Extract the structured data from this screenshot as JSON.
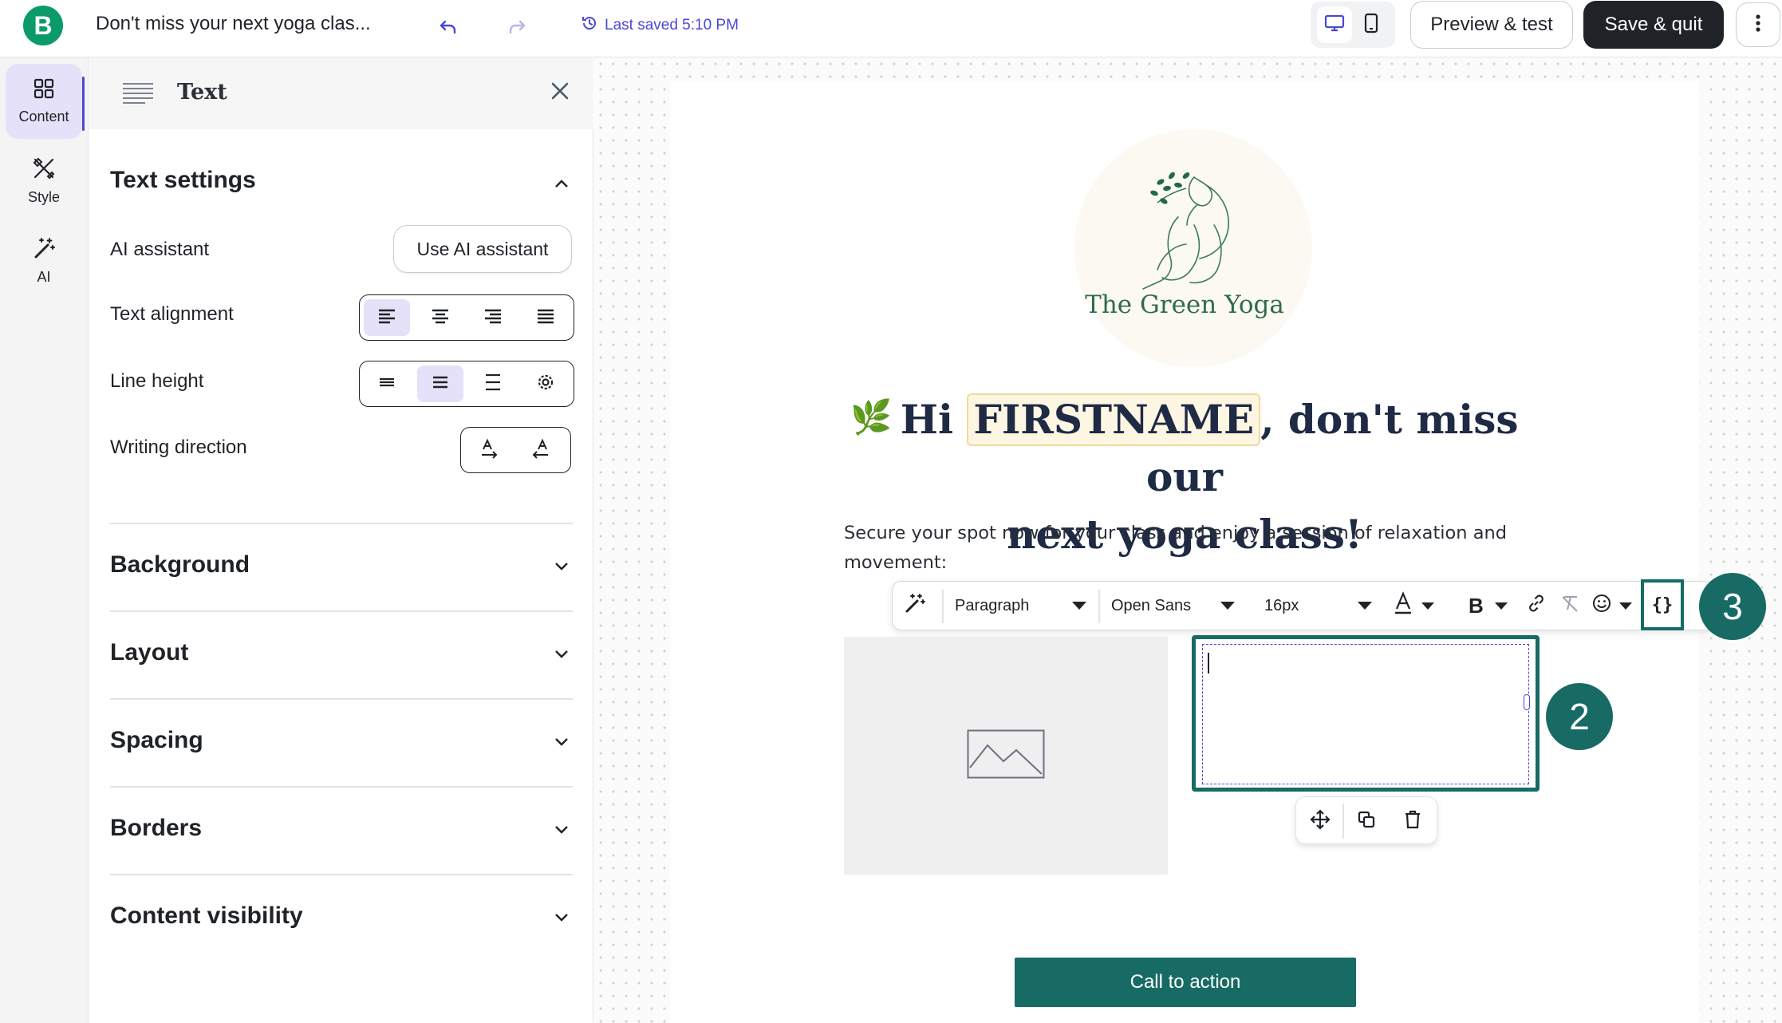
{
  "header": {
    "logo_letter": "B",
    "doc_title": "Don't miss your next yoga clas...",
    "last_saved": "Last saved 5:10 PM",
    "preview_label": "Preview & test",
    "save_label": "Save & quit"
  },
  "rail": {
    "items": [
      {
        "label": "Content",
        "icon": "grid-icon",
        "active": true
      },
      {
        "label": "Style",
        "icon": "brush-icon",
        "active": false
      },
      {
        "label": "AI",
        "icon": "magic-wand-icon",
        "active": false
      }
    ]
  },
  "panel": {
    "title": "Text",
    "text_settings": {
      "title": "Text settings",
      "ai_label": "AI assistant",
      "ai_button": "Use AI assistant",
      "alignment_label": "Text alignment",
      "alignment_options": [
        "left",
        "center",
        "right",
        "justify"
      ],
      "alignment_selected": "left",
      "line_height_label": "Line height",
      "line_height_options": [
        "compact",
        "normal",
        "loose",
        "custom"
      ],
      "line_height_selected": "normal",
      "direction_label": "Writing direction",
      "direction_options": [
        "ltr",
        "rtl"
      ]
    },
    "sections": [
      "Background",
      "Layout",
      "Spacing",
      "Borders",
      "Content visibility"
    ]
  },
  "email": {
    "brand": "The Green Yoga",
    "headline_prefix": "Hi",
    "headline_merge_tag": "FIRSTNAME",
    "headline_line1_suffix": ", don't miss our",
    "headline_line2": "next yoga class!",
    "body": "Secure your spot now for your class and enjoy a session of relaxation and movement:",
    "cta_label": "Call to action"
  },
  "editor_toolbar": {
    "block_type": "Paragraph",
    "font": "Open Sans",
    "font_size": "16px",
    "merge_tag_label": "{}"
  },
  "annotations": {
    "badge_2": "2",
    "badge_3": "3"
  },
  "colors": {
    "brand_green": "#0b9b6b",
    "accent_teal": "#176b64",
    "accent_purple": "#4a48d6",
    "selected_bg": "#e4e1f9"
  }
}
